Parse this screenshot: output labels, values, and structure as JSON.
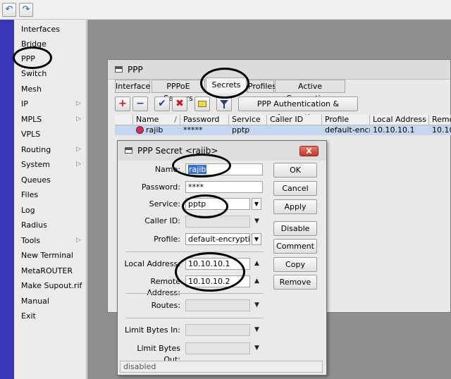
{
  "toolbar": {
    "undo_icon": "undo-icon",
    "redo_icon": "redo-icon"
  },
  "menu": {
    "items": [
      {
        "label": "Interfaces",
        "submenu": false
      },
      {
        "label": "Bridge",
        "submenu": false
      },
      {
        "label": "PPP",
        "submenu": false
      },
      {
        "label": "Switch",
        "submenu": false
      },
      {
        "label": "Mesh",
        "submenu": false
      },
      {
        "label": "IP",
        "submenu": true
      },
      {
        "label": "MPLS",
        "submenu": true
      },
      {
        "label": "VPLS",
        "submenu": false
      },
      {
        "label": "Routing",
        "submenu": true
      },
      {
        "label": "System",
        "submenu": true
      },
      {
        "label": "Queues",
        "submenu": false
      },
      {
        "label": "Files",
        "submenu": false
      },
      {
        "label": "Log",
        "submenu": false
      },
      {
        "label": "Radius",
        "submenu": false
      },
      {
        "label": "Tools",
        "submenu": true
      },
      {
        "label": "New Terminal",
        "submenu": false
      },
      {
        "label": "MetaROUTER",
        "submenu": false
      },
      {
        "label": "Make Supout.rif",
        "submenu": false
      },
      {
        "label": "Manual",
        "submenu": false
      },
      {
        "label": "Exit",
        "submenu": false
      }
    ],
    "submenu_arrow": "▷"
  },
  "ppp_window": {
    "title": "PPP",
    "tabs": [
      "Interface",
      "PPPoE Servers",
      "Secrets",
      "Profiles",
      "Active Connections"
    ],
    "active_tab": "Secrets",
    "toolbar": {
      "add": "+",
      "remove": "−",
      "enable": "✔",
      "disable": "✖",
      "comment_icon": "comment-icon",
      "filter_icon": "filter-icon",
      "auth_button": "PPP Authentication & Accounting"
    },
    "table": {
      "columns": [
        "Name",
        "Password",
        "Service",
        "Caller ID",
        "Profile",
        "Local Address",
        "Remote"
      ],
      "sort_marker": "/",
      "rows": [
        {
          "name": "rajib",
          "password": "*****",
          "service": "pptp",
          "caller_id": "",
          "profile": "default-encr...",
          "local_address": "10.10.10.1",
          "remote": "10.10.1"
        }
      ]
    },
    "colors": {
      "selected_row": "#c4d7ef",
      "workspace": "#8f8f8f",
      "menu_strip": "#3b35b9"
    }
  },
  "dialog": {
    "title": "PPP Secret <rajib>",
    "close": "X",
    "fields": {
      "name": {
        "label": "Name:",
        "value": "rajib"
      },
      "password": {
        "label": "Password:",
        "value": "****"
      },
      "service": {
        "label": "Service:",
        "value": "pptp"
      },
      "caller_id": {
        "label": "Caller ID:",
        "value": ""
      },
      "profile": {
        "label": "Profile:",
        "value": "default-encryption"
      },
      "local_address": {
        "label": "Local Address:",
        "value": "10.10.10.1"
      },
      "remote_address": {
        "label": "Remote Address:",
        "value": "10.10.10.2"
      },
      "routes": {
        "label": "Routes:",
        "value": ""
      },
      "limit_in": {
        "label": "Limit Bytes In:",
        "value": ""
      },
      "limit_out": {
        "label": "Limit Bytes Out:",
        "value": ""
      }
    },
    "buttons": {
      "ok": "OK",
      "cancel": "Cancel",
      "apply": "Apply",
      "disable": "Disable",
      "comment": "Comment",
      "copy": "Copy",
      "remove": "Remove"
    },
    "status": "disabled"
  }
}
